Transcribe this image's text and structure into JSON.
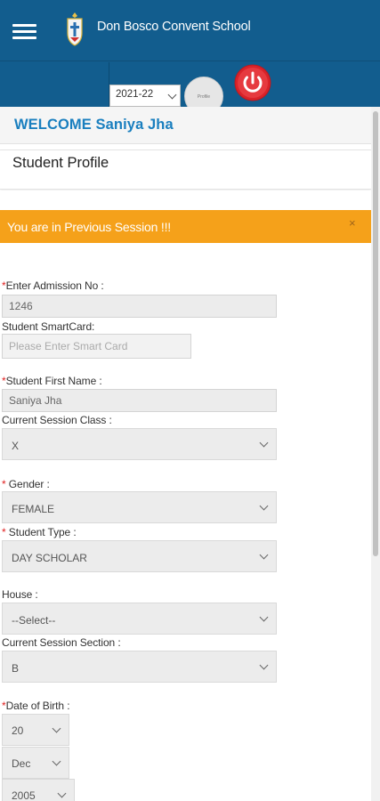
{
  "header": {
    "school_name": "Don Bosco Convent School",
    "session_select": "2021-22",
    "avatar_text": "Profile"
  },
  "welcome": "WELCOME Saniya Jha",
  "page_title": "Student Profile",
  "alert": {
    "text": "You are in Previous Session !!!",
    "close": "×"
  },
  "form": {
    "admission_label": "Enter Admission No :",
    "admission_value": "1246",
    "smartcard_label": "Student SmartCard:",
    "smartcard_placeholder": "Please Enter  Smart Card",
    "firstname_label": "Student First Name :",
    "firstname_value": "Saniya Jha",
    "class_label": "Current Session Class :",
    "class_value": "X",
    "gender_label": " Gender :",
    "gender_value": "FEMALE",
    "type_label": " Student Type :",
    "type_value": "DAY SCHOLAR",
    "house_label": "House :",
    "house_value": "--Select--",
    "section_label": "Current Session Section :",
    "section_value": "B",
    "dob_label": "Date of Birth :",
    "dob_day": "20",
    "dob_month": "Dec",
    "dob_year": "2005",
    "required_mark": "*"
  },
  "colors": {
    "header_bg": "#125d8e",
    "welcome_text": "#1a7fbf",
    "alert_bg": "#f5a11a",
    "power_button": "#d9232a"
  }
}
